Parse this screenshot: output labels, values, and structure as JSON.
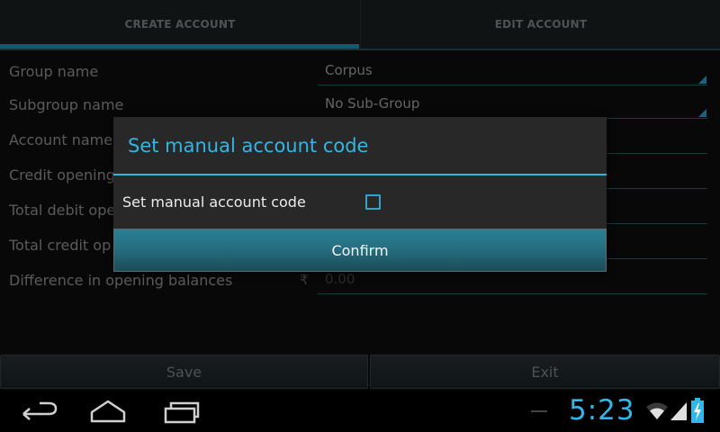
{
  "tabs": [
    {
      "label": "CREATE ACCOUNT",
      "selected": true
    },
    {
      "label": "EDIT ACCOUNT",
      "selected": false
    }
  ],
  "form": {
    "group_name_label": "Group name",
    "group_name_value": "Corpus",
    "subgroup_name_label": "Subgroup name",
    "subgroup_name_value": "No Sub-Group",
    "account_name_label": "Account name",
    "credit_opening_label": "Credit opening",
    "total_debit_label": "Total debit ope",
    "total_credit_label": "Total credit op",
    "difference_label": "Difference in opening balances",
    "currency_symbol": "₹",
    "difference_placeholder": "0.00"
  },
  "buttons": {
    "save": "Save",
    "exit": "Exit"
  },
  "dialog": {
    "title": "Set manual account code",
    "checkbox_label": "Set manual account code",
    "checkbox_checked": false,
    "confirm": "Confirm"
  },
  "status_bar": {
    "time": "5:23"
  },
  "colors": {
    "accent": "#33b5e5",
    "confirm_button": "#2b7f94",
    "background": "#101010"
  },
  "icons": [
    "back-icon",
    "home-icon",
    "recent-apps-icon",
    "wifi-icon",
    "signal-icon",
    "battery-charging-icon"
  ]
}
